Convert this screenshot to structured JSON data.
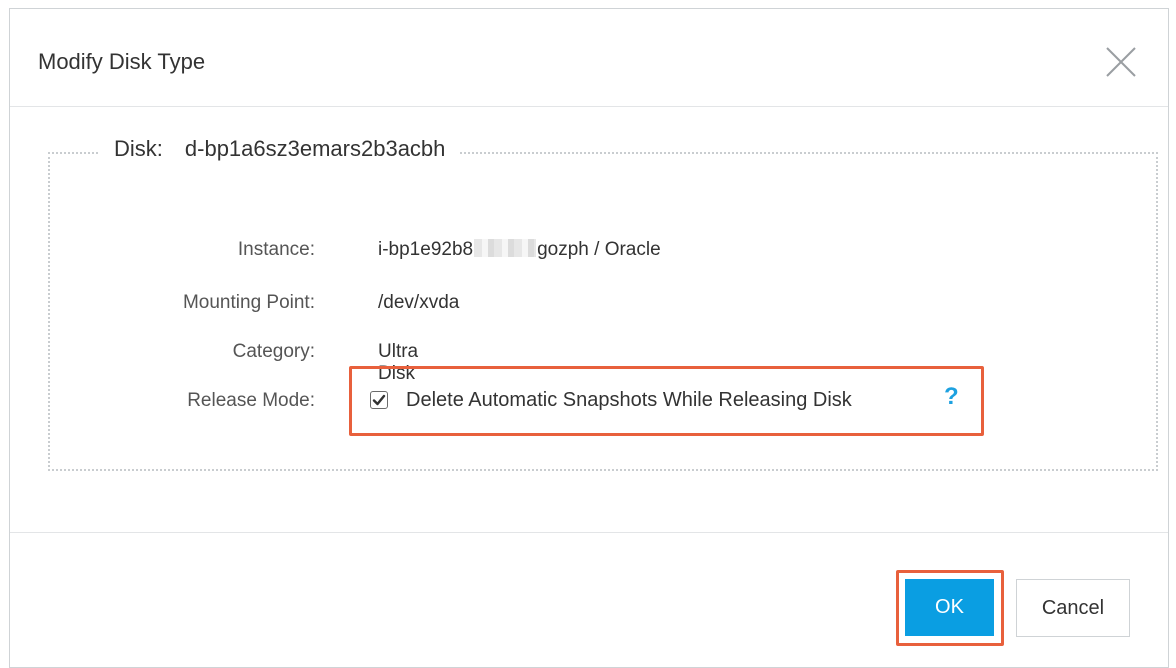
{
  "dialog": {
    "title": "Modify Disk Type",
    "close_icon": "close-icon"
  },
  "disk": {
    "label": "Disk:",
    "id": "d-bp1a6sz3emars2b3acbh"
  },
  "fields": {
    "instance_label": "Instance:",
    "instance_prefix": "i-bp1e92b8",
    "instance_suffix": "gozph / Oracle",
    "mount_label": "Mounting Point:",
    "mount_value": "/dev/xvda",
    "category_label": "Category:",
    "category_value": "Ultra Disk",
    "release_label": "Release Mode:",
    "release_option": "Delete Automatic Snapshots While Releasing Disk",
    "release_checked": true,
    "help_icon": "?"
  },
  "buttons": {
    "ok": "OK",
    "cancel": "Cancel"
  },
  "colors": {
    "accent": "#0a9ee2",
    "highlight": "#e8603c",
    "help": "#1da1e0"
  }
}
